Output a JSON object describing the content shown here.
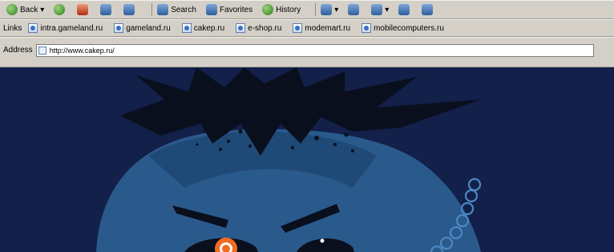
{
  "toolbar": {
    "back_label": "Back",
    "search_label": "Search",
    "favorites_label": "Favorites",
    "history_label": "History"
  },
  "links_bar": {
    "label": "Links",
    "items": [
      {
        "label": "intra.gameland.ru"
      },
      {
        "label": "gameland.ru"
      },
      {
        "label": "cakep.ru"
      },
      {
        "label": "e-shop.ru"
      },
      {
        "label": "modemart.ru"
      },
      {
        "label": "mobilecomputers.ru"
      }
    ]
  },
  "address_bar": {
    "label": "Address",
    "url": "http://www.cakep.ru/"
  },
  "colors": {
    "site_background": "#12204a",
    "mascot_face": "#2a5a8c",
    "hair": "#0a0f1e",
    "eye_ring": "#f26b21",
    "menu_ring": "#4b88c4"
  }
}
